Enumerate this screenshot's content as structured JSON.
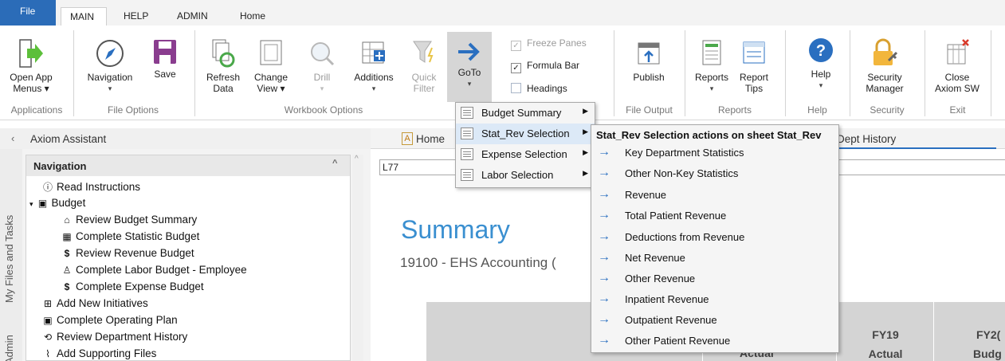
{
  "tabs": {
    "file": "File",
    "main": "MAIN",
    "help": "HELP",
    "admin": "ADMIN",
    "home": "Home"
  },
  "ribbon": {
    "open_app_menus": [
      "Open App",
      "Menus ▾"
    ],
    "navigation": "Navigation",
    "save": "Save",
    "refresh_data": [
      "Refresh",
      "Data"
    ],
    "change_view": [
      "Change",
      "View ▾"
    ],
    "drill": "Drill",
    "additions": "Additions",
    "quick_filter": [
      "Quick",
      "Filter"
    ],
    "goto": "GoTo",
    "freeze_panes": "Freeze Panes",
    "formula_bar": "Formula Bar",
    "headings": "Headings",
    "publish": "Publish",
    "reports": "Reports",
    "report_tips": [
      "Report",
      "Tips"
    ],
    "help": "Help",
    "security_manager": [
      "Security",
      "Manager"
    ],
    "close_axiom": [
      "Close",
      "Axiom SW"
    ],
    "groups": {
      "applications": "Applications",
      "file_options": "File Options",
      "workbook_options": "Workbook Options",
      "file_output": "File Output",
      "reports": "Reports",
      "help": "Help",
      "security": "Security",
      "exit": "Exit"
    }
  },
  "assistant": {
    "title": "Axiom Assistant",
    "vtab_files": "My Files and Tasks",
    "vtab_admin": "Admin",
    "nav_title": "Navigation",
    "items": {
      "read_instructions": "Read Instructions",
      "budget": "Budget",
      "review_budget_summary": "Review Budget Summary",
      "complete_statistic_budget": "Complete Statistic Budget",
      "review_revenue_budget": "Review Revenue Budget",
      "complete_labor_budget": "Complete Labor Budget - Employee",
      "complete_expense_budget": "Complete Expense Budget",
      "add_new_initiatives": "Add New Initiatives",
      "complete_operating_plan": "Complete Operating Plan",
      "review_department_history": "Review Department History",
      "add_supporting_files": "Add Supporting Files"
    }
  },
  "sheet": {
    "tab_home": "Home",
    "tab_dept_history": "Dept History",
    "cell_ref": "L77",
    "summary_title": "Summary",
    "summary_subtitle": "19100 - EHS Accounting (",
    "col_fy19_a": "FY19",
    "col_fy19_b": "Actual",
    "col_actual_partial": "Actual",
    "col_fy2_a": "FY2(",
    "col_fy2_b": "Budg"
  },
  "goto_menu": {
    "items": [
      "Budget Summary",
      "Stat_Rev Selection",
      "Expense Selection",
      "Labor Selection"
    ],
    "submenu_title": "Stat_Rev Selection actions on sheet Stat_Rev",
    "sub_items": [
      "Key Department Statistics",
      "Other Non-Key Statistics",
      "Revenue",
      "Total Patient Revenue",
      "Deductions from Revenue",
      "Net Revenue",
      "Other Revenue",
      "Inpatient Revenue",
      "Outpatient Revenue",
      "Other Patient Revenue"
    ]
  },
  "colors": {
    "file_tab": "#2b6cb8",
    "goto_active": "#d6d6d6",
    "accent_blue": "#2a6fc0",
    "summary_title": "#3a8fd0"
  }
}
